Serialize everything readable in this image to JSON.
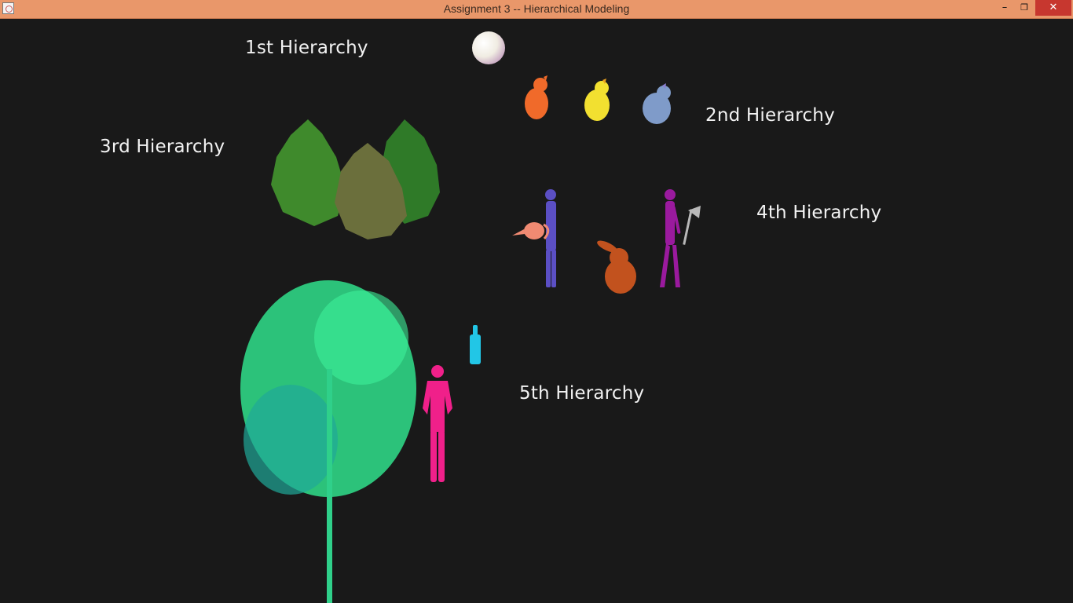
{
  "window": {
    "title": "Assignment 3 -- Hierarchical Modeling",
    "minimize_glyph": "–",
    "maximize_glyph": "❐",
    "close_glyph": "✕"
  },
  "labels": {
    "h1": "1st  Hierarchy",
    "h2": "2nd Hierarchy",
    "h3": "3rd Hierarchy",
    "h4": "4th Hierarchy",
    "h5": "5th  Hierarchy"
  },
  "colors": {
    "background": "#191919",
    "titlebar": "#e9976a",
    "close_button": "#c7372f",
    "label_text": "#f2f2f2",
    "moon": "#f3efe6",
    "bird_orange": "#f06a2a",
    "bird_yellow": "#f2e030",
    "bird_blue": "#7f9bc9",
    "bush_green": "#3f8a2c",
    "bush_olive": "#6b6f3c",
    "figure_blue": "#5b4fc4",
    "teapot": "#f08a72",
    "bunny": "#c2521e",
    "figure_purple": "#9a1a9e",
    "axe": "#b8b8b8",
    "tree_leaves": "#30e08c",
    "bottle": "#22c6e6",
    "figure_pink": "#f0208a"
  },
  "icons": [
    "java-app-icon",
    "minimize-icon",
    "maximize-icon",
    "close-icon"
  ]
}
